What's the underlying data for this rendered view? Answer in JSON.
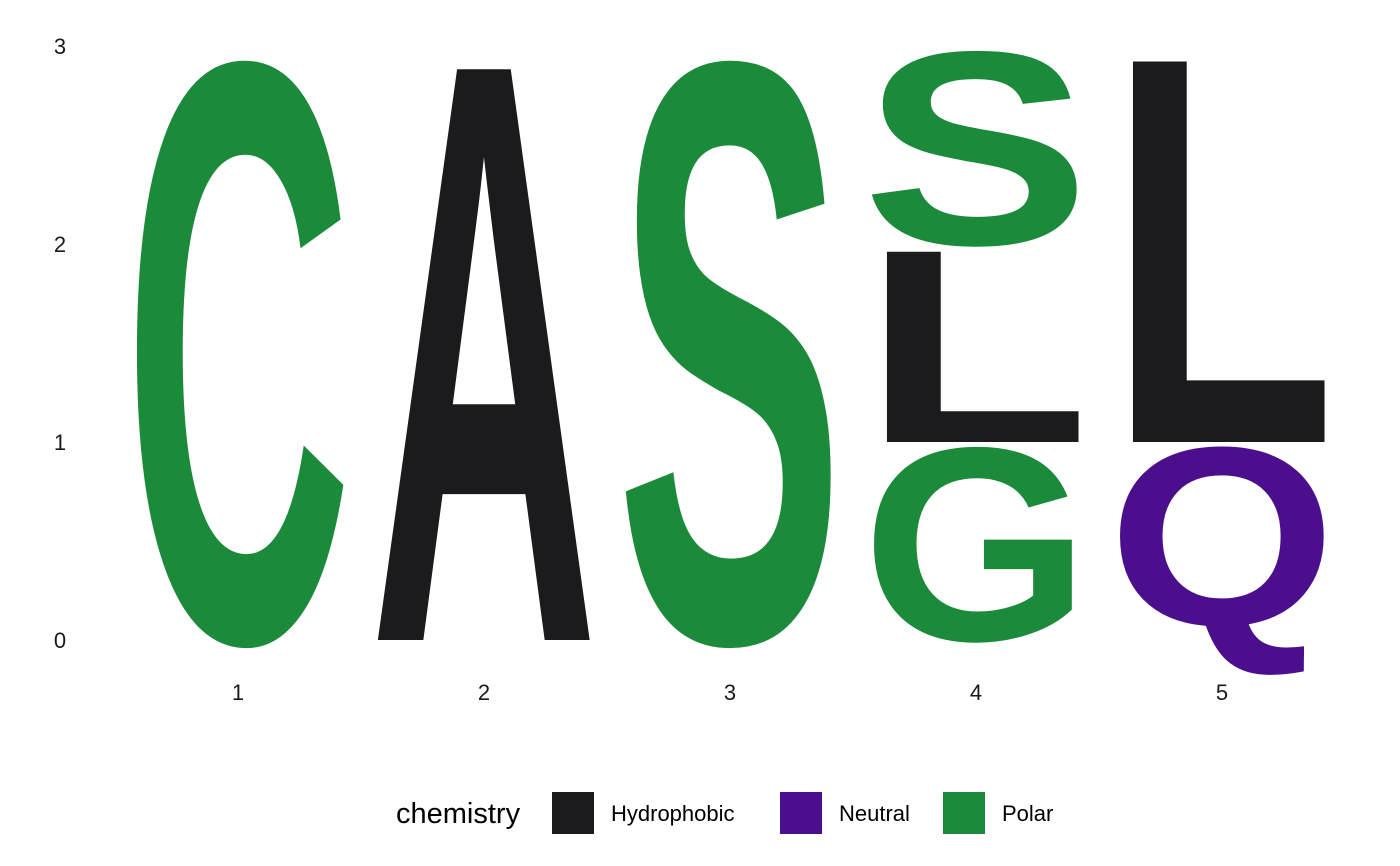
{
  "chart_data": {
    "type": "sequence-logo",
    "y_ticks": [
      0,
      1,
      2,
      3
    ],
    "ylim": [
      0,
      3
    ],
    "positions": [
      1,
      2,
      3,
      4,
      5
    ],
    "stacks": [
      {
        "position": 1,
        "letters": [
          {
            "letter": "C",
            "height": 3.0,
            "chemistry": "Polar"
          }
        ]
      },
      {
        "position": 2,
        "letters": [
          {
            "letter": "A",
            "height": 3.0,
            "chemistry": "Hydrophobic"
          }
        ]
      },
      {
        "position": 3,
        "letters": [
          {
            "letter": "S",
            "height": 3.0,
            "chemistry": "Polar"
          }
        ]
      },
      {
        "position": 4,
        "letters": [
          {
            "letter": "G",
            "height": 1.0,
            "chemistry": "Polar"
          },
          {
            "letter": "L",
            "height": 1.0,
            "chemistry": "Hydrophobic"
          },
          {
            "letter": "S",
            "height": 1.0,
            "chemistry": "Polar"
          }
        ]
      },
      {
        "position": 5,
        "letters": [
          {
            "letter": "Q",
            "height": 1.0,
            "chemistry": "Neutral"
          },
          {
            "letter": "L",
            "height": 2.0,
            "chemistry": "Hydrophobic"
          }
        ]
      }
    ],
    "legend": {
      "title": "chemistry",
      "position": "bottom",
      "entries": [
        {
          "label": "Hydrophobic",
          "color": "#1b1a1d"
        },
        {
          "label": "Neutral",
          "color": "#4b0f8e"
        },
        {
          "label": "Polar",
          "color": "#1b8a3a"
        }
      ]
    },
    "grid": false
  }
}
